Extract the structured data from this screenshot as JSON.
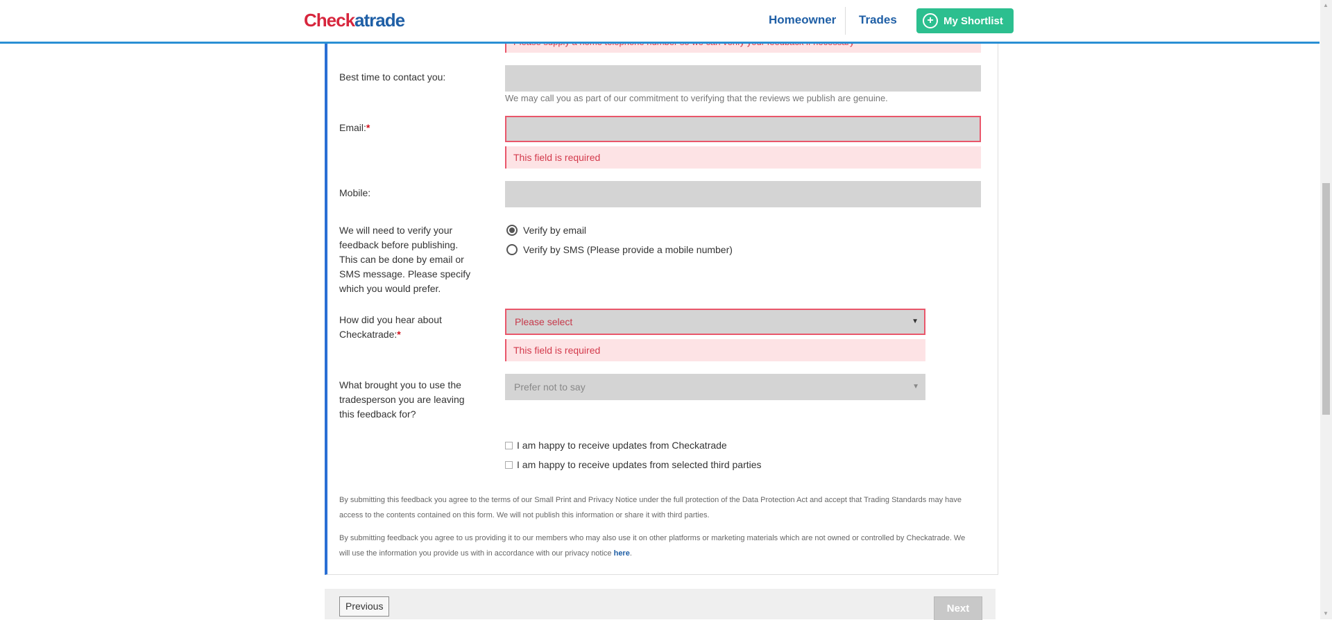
{
  "header": {
    "logo_part1": "Check",
    "logo_part2": "atrade",
    "nav": {
      "homeowner": "Homeowner",
      "trades": "Trades"
    },
    "shortlist_label": "My Shortlist"
  },
  "form": {
    "partial_error": "Please supply a home telephone number so we can verify your feedback if necessary",
    "best_time": {
      "label": "Best time to contact you:",
      "help": "We may call you as part of our commitment to verifying that the reviews we publish are genuine."
    },
    "email": {
      "label": "Email:",
      "required_mark": "*",
      "error": "This field is required"
    },
    "mobile": {
      "label": "Mobile:"
    },
    "verify": {
      "label": "We will need to verify your feedback before publishing. This can be done by email or SMS message. Please specify which you would prefer.",
      "option_email": "Verify by email",
      "option_sms": "Verify by SMS (Please provide a mobile number)",
      "selected": "email"
    },
    "hear_about": {
      "label": "How did you hear about Checkatrade:",
      "required_mark": "*",
      "selected": "Please select",
      "error": "This field is required"
    },
    "reason": {
      "label": "What brought you to use the tradesperson you are leaving this feedback for?",
      "selected": "Prefer not to say"
    },
    "consent_checkatrade": "I am happy to receive updates from Checkatrade",
    "consent_third_party": "I am happy to receive updates from selected third parties",
    "legal_1": "By submitting this feedback you agree to the terms of our Small Print and Privacy Notice under the full protection of the Data Protection Act and accept that Trading Standards may have access to the contents contained on this form. We will not publish this information or share it with third parties.",
    "legal_2": "By submitting feedback you agree to us providing it to our members who may also use it on other platforms or marketing materials which are not owned or controlled by Checkatrade. We will use the information you provide us with in accordance with our privacy notice",
    "legal_2_link": "here",
    "legal_2_end": "."
  },
  "buttons": {
    "previous": "Previous",
    "next": "Next"
  },
  "colors": {
    "accent_blue": "#2a6fd4",
    "brand_red": "#d7263d",
    "brand_blue": "#1f5fa6",
    "shortlist_green": "#2cbf8f",
    "error_red": "#e9566a"
  }
}
